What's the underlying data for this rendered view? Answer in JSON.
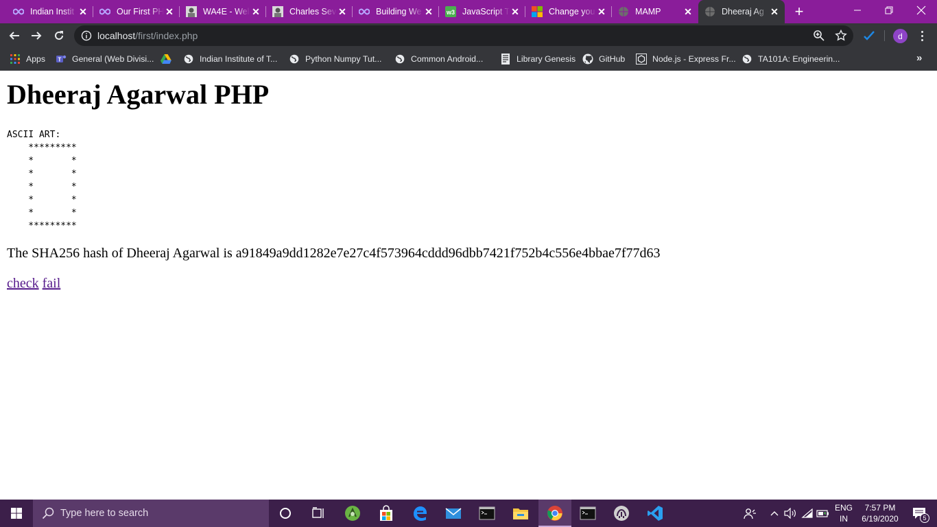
{
  "browser": {
    "tabs": [
      {
        "title": "Indian Instit",
        "favicon": "infinity-icon",
        "active": false
      },
      {
        "title": "Our First PH",
        "favicon": "infinity-icon",
        "active": false
      },
      {
        "title": "WA4E - Wel",
        "favicon": "portrait-icon",
        "active": false
      },
      {
        "title": "Charles Sev",
        "favicon": "portrait-icon",
        "active": false
      },
      {
        "title": "Building We",
        "favicon": "infinity-icon",
        "active": false
      },
      {
        "title": "JavaScript T",
        "favicon": "w3schools-icon",
        "active": false
      },
      {
        "title": "Change you",
        "favicon": "microsoft-icon",
        "active": false
      },
      {
        "title": "MAMP",
        "favicon": "globe-icon",
        "active": false
      },
      {
        "title": "Dheeraj Ag",
        "favicon": "globe-icon",
        "active": true
      }
    ],
    "url_host": "localhost",
    "url_path": "/first/index.php",
    "profile_initial": "d",
    "accent_color": "#8a1d9a"
  },
  "bookmarks": [
    {
      "label": "Apps",
      "icon": "apps-grid-icon"
    },
    {
      "label": "General (Web Divisi...",
      "icon": "teams-icon"
    },
    {
      "label": "",
      "icon": "google-drive-icon"
    },
    {
      "label": "Indian Institute of T...",
      "icon": "globe-icon"
    },
    {
      "label": "Python Numpy Tut...",
      "icon": "globe-icon"
    },
    {
      "label": "Common Android...",
      "icon": "globe-icon"
    },
    {
      "label": "Library Genesis",
      "icon": "book-icon"
    },
    {
      "label": "GitHub",
      "icon": "github-icon"
    },
    {
      "label": "Node.js - Express Fr...",
      "icon": "node-icon"
    },
    {
      "label": "TA101A: Engineerin...",
      "icon": "globe-icon"
    }
  ],
  "page": {
    "heading": "Dheeraj Agarwal PHP",
    "ascii_art": "ASCII ART:\n    *********\n    *       *\n    *       *\n    *       *\n    *       *\n    *       *\n    *********",
    "hash_text": "The SHA256 hash of Dheeraj Agarwal is a91849a9dd1282e7e27c4f573964cddd96dbb7421f752b4c556e4bbae7f77d63",
    "link_check": "check",
    "link_fail": "fail"
  },
  "taskbar": {
    "search_placeholder": "Type here to search",
    "language_line1": "ENG",
    "language_line2": "IN",
    "time": "7:57 PM",
    "date": "6/19/2020",
    "notification_count": "5"
  }
}
